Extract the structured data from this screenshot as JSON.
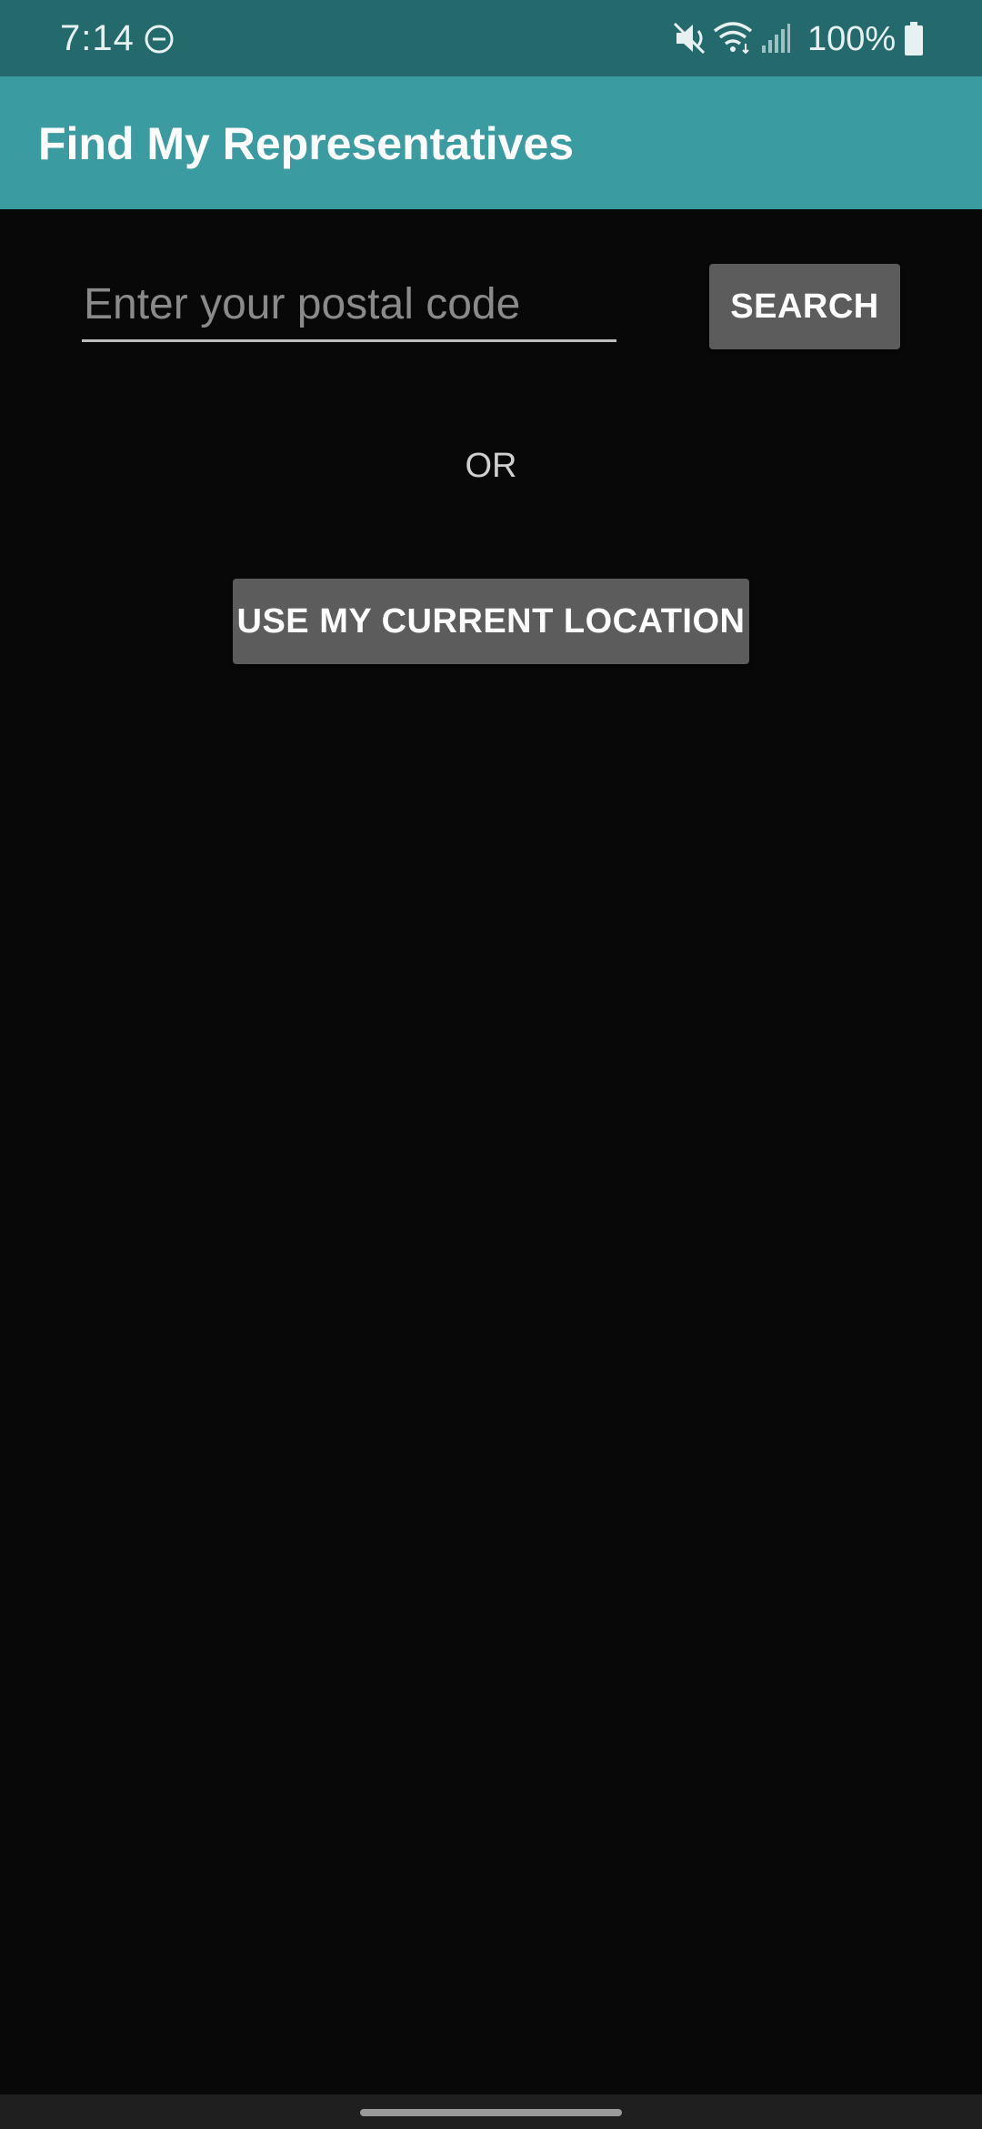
{
  "status_bar": {
    "time": "7:14",
    "battery_percent": "100%",
    "icons": [
      "do-not-disturb-icon",
      "mute-icon",
      "wifi-icon",
      "signal-icon",
      "battery-icon"
    ],
    "background_color": "#246a6c"
  },
  "app_bar": {
    "title": "Find My Representatives",
    "background_color": "#3a9ba0"
  },
  "search": {
    "placeholder": "Enter your postal code",
    "value": "",
    "button_label": "SEARCH"
  },
  "separator": {
    "label": "OR"
  },
  "location": {
    "button_label": "USE MY CURRENT LOCATION"
  },
  "theme": {
    "background": "#080808",
    "button_color": "#5c5c5c"
  }
}
